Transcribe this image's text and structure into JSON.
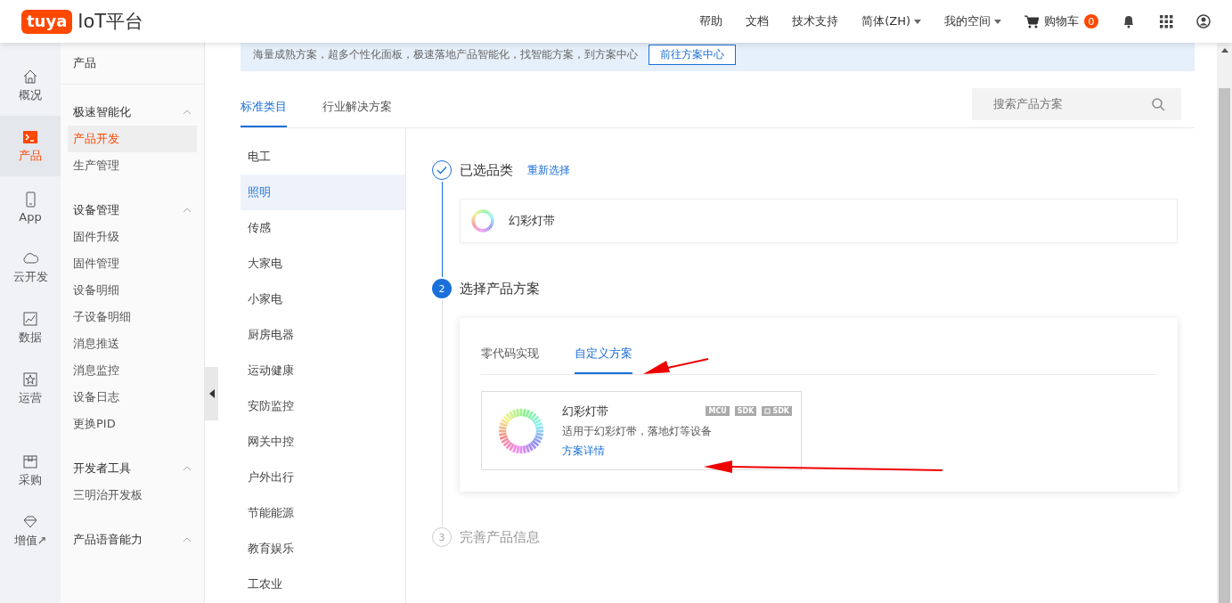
{
  "header": {
    "logo_badge": "tuya",
    "logo_text": "IoT平台",
    "nav": [
      {
        "label": "帮助",
        "dropdown": false
      },
      {
        "label": "文档",
        "dropdown": false
      },
      {
        "label": "技术支持",
        "dropdown": false
      },
      {
        "label": "简体(ZH)",
        "dropdown": true
      },
      {
        "label": "我的空间",
        "dropdown": true
      }
    ],
    "cart": {
      "label": "购物车",
      "count": "0"
    }
  },
  "rail": {
    "items": [
      {
        "label": "概况",
        "selected": false
      },
      {
        "label": "产品",
        "selected": true
      },
      {
        "label": "App",
        "selected": false
      },
      {
        "label": "云开发",
        "selected": false
      },
      {
        "label": "数据",
        "selected": false
      },
      {
        "label": "运营",
        "selected": false
      },
      {
        "label": "采购",
        "selected": false
      },
      {
        "label": "增值↗",
        "selected": false
      }
    ]
  },
  "subnav": {
    "title": "产品",
    "groups": [
      {
        "title": "极速智能化",
        "expanded": true,
        "items": [
          {
            "label": "产品开发",
            "selected": true
          },
          {
            "label": "生产管理",
            "selected": false
          }
        ]
      },
      {
        "title": "设备管理",
        "expanded": true,
        "items": [
          {
            "label": "固件升级",
            "selected": false
          },
          {
            "label": "固件管理",
            "selected": false
          },
          {
            "label": "设备明细",
            "selected": false
          },
          {
            "label": "子设备明细",
            "selected": false
          },
          {
            "label": "消息推送",
            "selected": false
          },
          {
            "label": "消息监控",
            "selected": false
          },
          {
            "label": "设备日志",
            "selected": false
          },
          {
            "label": "更换PID",
            "selected": false
          }
        ]
      },
      {
        "title": "开发者工具",
        "expanded": true,
        "items": [
          {
            "label": "三明治开发板",
            "selected": false
          }
        ]
      },
      {
        "title": "产品语音能力",
        "expanded": true
      }
    ]
  },
  "banner": {
    "text": "海量成熟方案，超多个性化面板，极速落地产品智能化，找智能方案，到方案中心",
    "button": "前往方案中心"
  },
  "tabs": [
    {
      "label": "标准类目",
      "selected": true
    },
    {
      "label": "行业解决方案",
      "selected": false
    }
  ],
  "search": {
    "placeholder": "搜索产品方案"
  },
  "categories": [
    {
      "label": "电工",
      "selected": false
    },
    {
      "label": "照明",
      "selected": true
    },
    {
      "label": "传感",
      "selected": false
    },
    {
      "label": "大家电",
      "selected": false
    },
    {
      "label": "小家电",
      "selected": false
    },
    {
      "label": "厨房电器",
      "selected": false
    },
    {
      "label": "运动健康",
      "selected": false
    },
    {
      "label": "安防监控",
      "selected": false
    },
    {
      "label": "网关中控",
      "selected": false
    },
    {
      "label": "户外出行",
      "selected": false
    },
    {
      "label": "节能能源",
      "selected": false
    },
    {
      "label": "教育娱乐",
      "selected": false
    },
    {
      "label": "工农业",
      "selected": false
    }
  ],
  "steps": [
    {
      "kind": "done",
      "title": "已选品类",
      "link": "重新选择",
      "category": "幻彩灯带"
    },
    {
      "kind": "current",
      "number": "2",
      "title": "选择产品方案",
      "tabs": [
        {
          "label": "零代码实现",
          "selected": false
        },
        {
          "label": "自定义方案",
          "selected": true
        }
      ],
      "solution": {
        "name": "幻彩灯带",
        "tags": [
          {
            "label": "MCU",
            "chip": false
          },
          {
            "label": "SDK",
            "chip": false
          },
          {
            "label": "SDK",
            "chip": true
          }
        ],
        "description": "适用于幻彩灯带，落地灯等设备",
        "link": "方案详情"
      }
    },
    {
      "kind": "pending",
      "number": "3",
      "title": "完善产品信息"
    }
  ]
}
